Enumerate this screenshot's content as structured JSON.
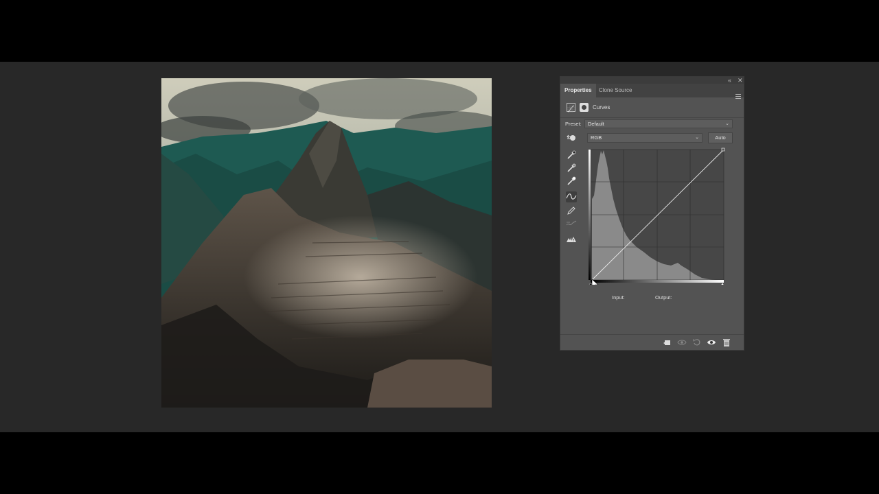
{
  "panel": {
    "tabs": [
      {
        "label": "Properties",
        "active": true
      },
      {
        "label": "Clone Source",
        "active": false
      }
    ],
    "adjustment": {
      "title": "Curves",
      "icon": "curves-adjustment-icon"
    },
    "preset": {
      "label": "Preset:",
      "value": "Default"
    },
    "channel": {
      "value": "RGB"
    },
    "auto_label": "Auto",
    "tools": [
      {
        "name": "targeted-adjustment-icon"
      },
      {
        "name": "black-point-eyedropper-icon"
      },
      {
        "name": "gray-point-eyedropper-icon"
      },
      {
        "name": "white-point-eyedropper-icon"
      },
      {
        "name": "curve-points-icon",
        "active": true
      },
      {
        "name": "pencil-draw-icon"
      },
      {
        "name": "smooth-curve-icon"
      },
      {
        "name": "clipping-warning-icon"
      }
    ],
    "input_label": "Input:",
    "output_label": "Output:",
    "footer_buttons": [
      "clip-to-layer-icon",
      "view-previous-state-icon",
      "reset-icon",
      "visibility-eye-icon",
      "trash-icon"
    ]
  },
  "colors": {
    "workspace": "#282828",
    "panel": "#535353",
    "sky": "#d7d6c6",
    "teal_mountains": "#1f5a52",
    "ruins": "#7a6c5e"
  }
}
